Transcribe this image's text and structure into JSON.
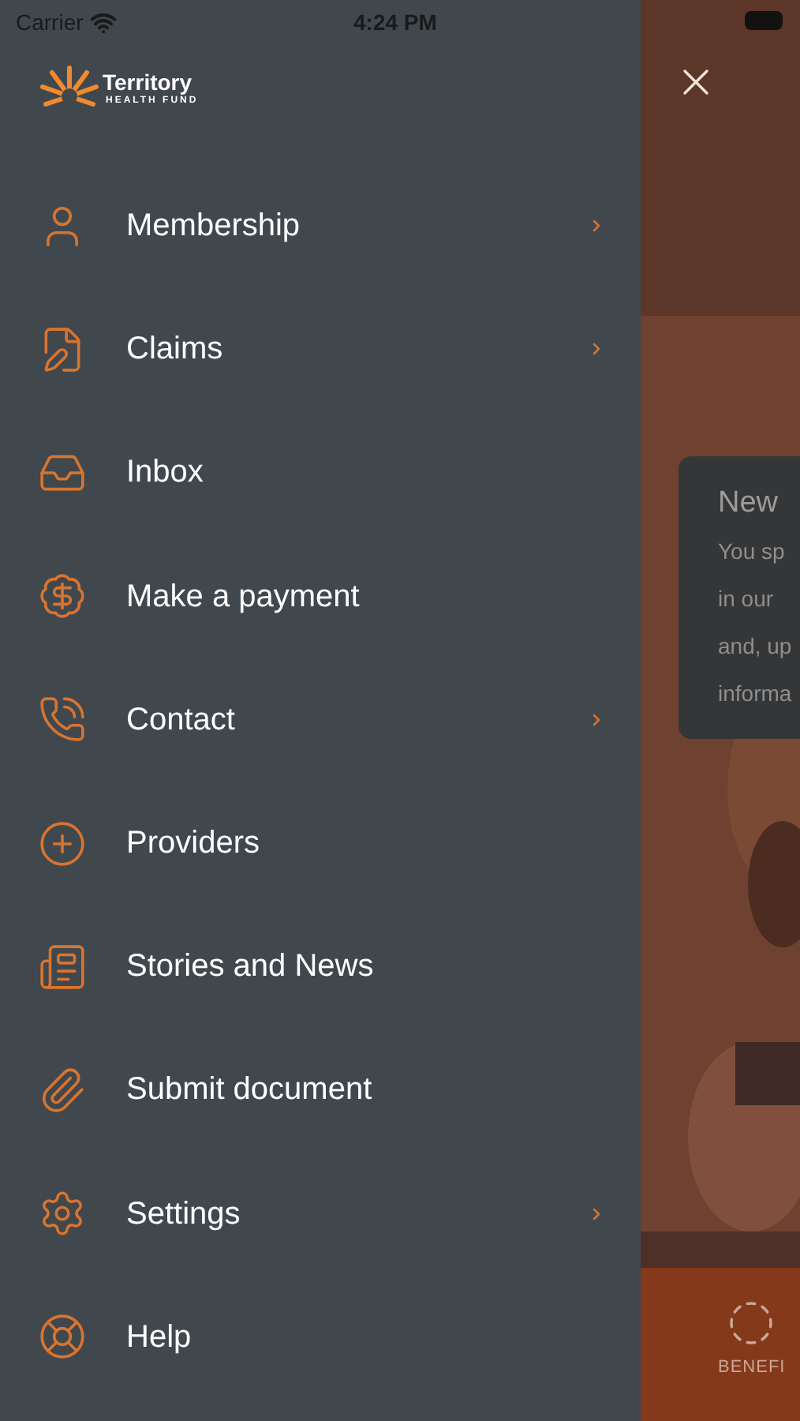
{
  "status_bar": {
    "carrier": "Carrier",
    "time": "4:24 PM"
  },
  "logo": {
    "name": "Territory",
    "tagline": "HEALTH FUND"
  },
  "menu": [
    {
      "label": "Membership",
      "has_submenu": true
    },
    {
      "label": "Claims",
      "has_submenu": true
    },
    {
      "label": "Inbox",
      "has_submenu": false
    },
    {
      "label": "Make a payment",
      "has_submenu": false
    },
    {
      "label": "Contact",
      "has_submenu": true
    },
    {
      "label": "Providers",
      "has_submenu": false
    },
    {
      "label": "Stories and News",
      "has_submenu": false
    },
    {
      "label": "Submit document",
      "has_submenu": false
    },
    {
      "label": "Settings",
      "has_submenu": true
    },
    {
      "label": "Help",
      "has_submenu": false
    }
  ],
  "background_card": {
    "title": "New",
    "lines": [
      "You sp",
      "in our",
      "and, up",
      "informa"
    ]
  },
  "tab_bar": {
    "tabs": [
      {
        "label": "BENEFI"
      }
    ]
  }
}
